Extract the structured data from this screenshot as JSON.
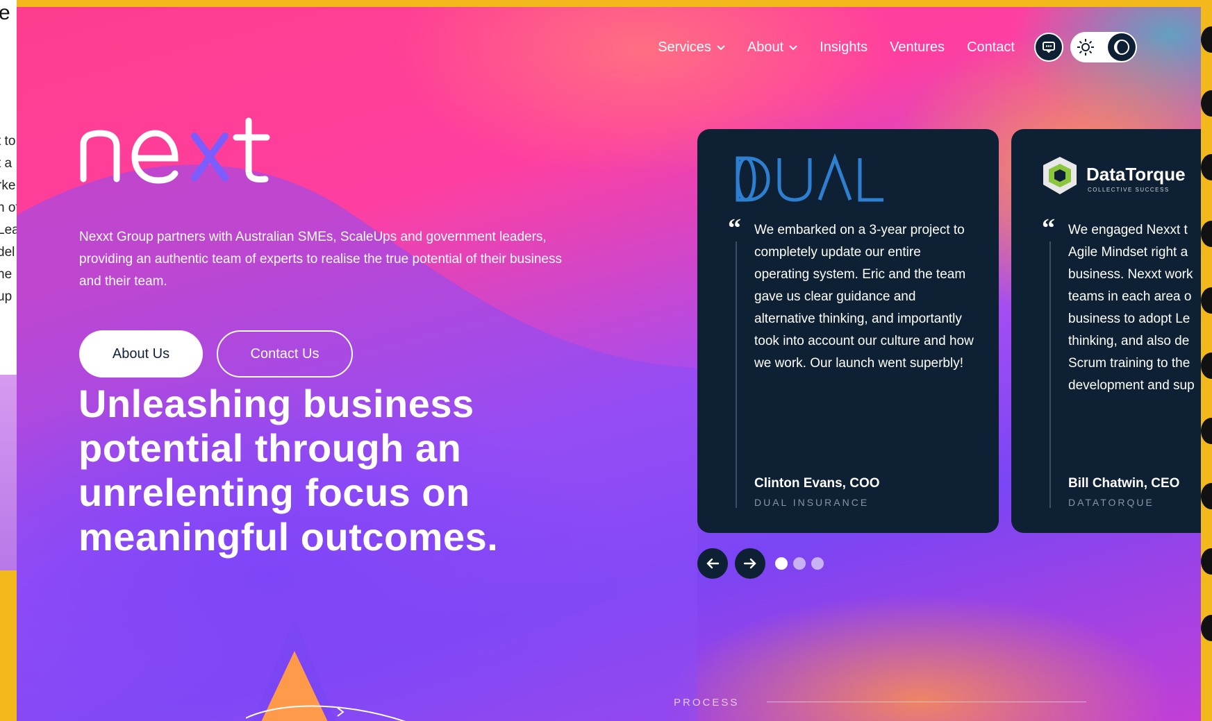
{
  "peek": {
    "title": "e",
    "lines": [
      "t to",
      "t a",
      "rke",
      "n of",
      "Lea",
      "del",
      "he",
      "up"
    ]
  },
  "nav": {
    "items": [
      {
        "label": "Services",
        "dropdown": true
      },
      {
        "label": "About",
        "dropdown": true
      },
      {
        "label": "Insights",
        "dropdown": false
      },
      {
        "label": "Ventures",
        "dropdown": false
      },
      {
        "label": "Contact",
        "dropdown": false
      }
    ],
    "icons": [
      "chat-icon",
      "sun-icon",
      "moon-icon"
    ]
  },
  "hero": {
    "logo_text": "nexxt",
    "intro": "Nexxt Group partners with Australian SMEs, ScaleUps and government leaders, providing an authentic team of experts to realise the true potential of their business and their team.",
    "primary_button": "About Us",
    "secondary_button": "Contact Us",
    "headline": "Unleashing business potential through an unrelenting focus on meaningful outcomes."
  },
  "testimonials": [
    {
      "logo": "DUAL",
      "quote": "We embarked on a 3-year project to completely update our entire operating system. Eric and the team gave us clear guidance and alternative thinking, and importantly took into account our culture and how we work. Our launch went superbly!",
      "author": "Clinton Evans, COO",
      "org": "DUAL INSURANCE"
    },
    {
      "logo": "DataTorque",
      "logo_tagline": "COLLECTIVE SUCCESS",
      "quote_lines": [
        "We engaged Nexxt t",
        "Agile Mindset right a",
        "business. Nexxt work",
        "teams in each area o",
        "business to adopt Le",
        "thinking, and also de",
        "Scrum training to the",
        "development and sup"
      ],
      "author": "Bill Chatwin, CEO",
      "org": "DATATORQUE"
    }
  ],
  "carousel": {
    "total": 3,
    "active": 1,
    "icons": [
      "arrow-left-icon",
      "arrow-right-icon"
    ]
  },
  "process": {
    "label": "PROCESS"
  },
  "colors": {
    "navy": "#0d2034",
    "pink": "#ff3d8e",
    "violet": "#7a45f4",
    "orange": "#ff9a4a",
    "dual_blue": "#2e7fd0",
    "datatorque_green": "#8cc63f"
  }
}
